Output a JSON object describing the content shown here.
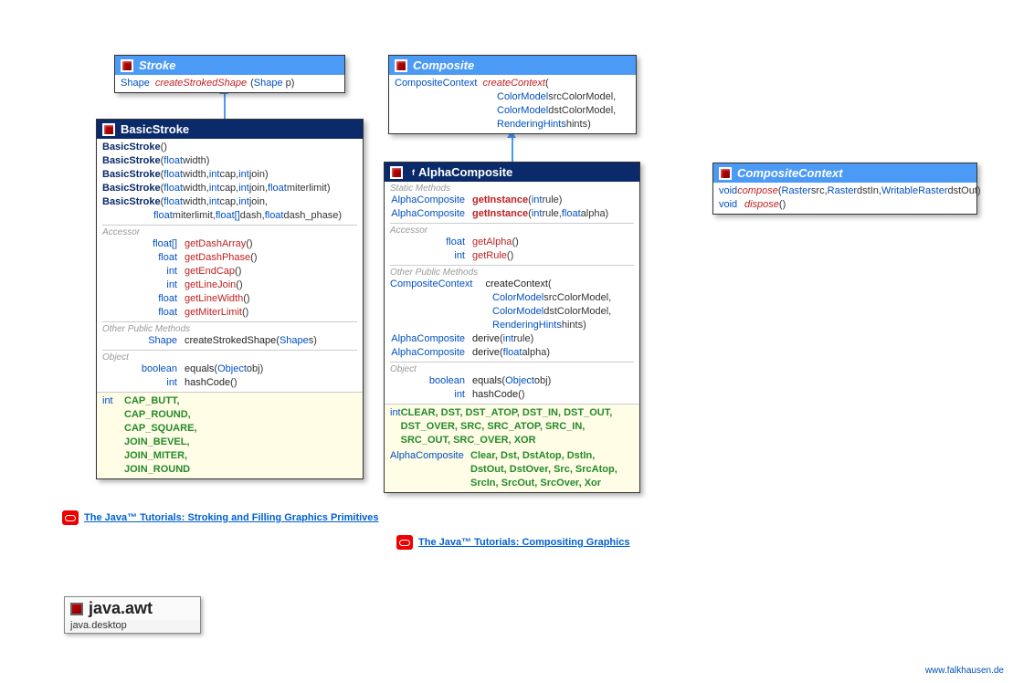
{
  "stroke": {
    "title": "Stroke",
    "method_ret": "Shape",
    "method_name": "createStrokedShape",
    "method_params": "(Shape p)"
  },
  "basicStroke": {
    "title": "BasicStroke",
    "constructors": [
      {
        "sig": "()"
      },
      {
        "sig": "(float width)"
      },
      {
        "sig": "(float width, int cap, int join)"
      },
      {
        "sig": "(float width, int cap, int join, float miterlimit)"
      },
      {
        "sig": "(float width, int cap, int join,",
        "cont": "float miterlimit, float[] dash, float dash_phase)"
      }
    ],
    "section_accessor": "Accessor",
    "accessors": [
      {
        "ret": "float[]",
        "name": "getDashArray",
        "params": "()"
      },
      {
        "ret": "float",
        "name": "getDashPhase",
        "params": "()"
      },
      {
        "ret": "int",
        "name": "getEndCap",
        "params": "()"
      },
      {
        "ret": "int",
        "name": "getLineJoin",
        "params": "()"
      },
      {
        "ret": "float",
        "name": "getLineWidth",
        "params": "()"
      },
      {
        "ret": "float",
        "name": "getMiterLimit",
        "params": "()"
      }
    ],
    "section_other": "Other Public Methods",
    "other_ret": "Shape",
    "other_name": "createStrokedShape",
    "other_params": "(Shape s)",
    "section_object": "Object",
    "equals_ret": "boolean",
    "equals_name": "equals",
    "equals_params": "(Object obj)",
    "hash_ret": "int",
    "hash_name": "hashCode",
    "hash_params": "()",
    "const_ret": "int",
    "constants": [
      "CAP_BUTT,",
      "CAP_ROUND,",
      "CAP_SQUARE,",
      "JOIN_BEVEL,",
      "JOIN_MITER,",
      "JOIN_ROUND"
    ]
  },
  "composite": {
    "title": "Composite",
    "ret": "CompositeContext",
    "name": "createContext",
    "open": "(",
    "p1": "ColorModel srcColorModel,",
    "p2": "ColorModel dstColorModel,",
    "p3": "RenderingHints hints)"
  },
  "alphaComposite": {
    "title": "AlphaComposite",
    "marker": "f",
    "section_static": "Static Methods",
    "getInstance1_ret": "AlphaComposite",
    "getInstance1_name": "getInstance",
    "getInstance1_params": "(int rule)",
    "getInstance2_ret": "AlphaComposite",
    "getInstance2_name": "getInstance",
    "getInstance2_params": "(int rule, float alpha)",
    "section_accessor": "Accessor",
    "getAlpha_ret": "float",
    "getAlpha_name": "getAlpha",
    "getAlpha_params": "()",
    "getRule_ret": "int",
    "getRule_name": "getRule",
    "getRule_params": "()",
    "section_other": "Other Public Methods",
    "cc_ret": "CompositeContext",
    "cc_name": "createContext",
    "cc_open": "(",
    "cc_p1": "ColorModel srcColorModel,",
    "cc_p2": "ColorModel dstColorModel,",
    "cc_p3": "RenderingHints hints)",
    "derive1_ret": "AlphaComposite",
    "derive1_name": "derive",
    "derive1_params": "(int rule)",
    "derive2_ret": "AlphaComposite",
    "derive2_name": "derive",
    "derive2_params": "(float alpha)",
    "section_object": "Object",
    "equals_ret": "boolean",
    "equals_name": "equals",
    "equals_params": "(Object obj)",
    "hash_ret": "int",
    "hash_name": "hashCode",
    "hash_params": "()",
    "int_const_ret": "int",
    "int_constants": "CLEAR, DST, DST_ATOP, DST_IN, DST_OUT, DST_OVER, SRC, SRC_ATOP, SRC_IN, SRC_OUT, SRC_OVER, XOR",
    "obj_const_ret": "AlphaComposite",
    "obj_constants": "Clear, Dst, DstAtop, DstIn, DstOut, DstOver, Src, SrcAtop, SrcIn, SrcOut, SrcOver, Xor"
  },
  "compositeContext": {
    "title": "CompositeContext",
    "compose_ret": "void",
    "compose_name": "compose",
    "compose_params": "(Raster src, Raster dstIn, WritableRaster dstOut)",
    "dispose_ret": "void",
    "dispose_name": "dispose",
    "dispose_params": "()"
  },
  "link1": "The Java™ Tutorials: Stroking and Filling Graphics Primitives",
  "link2": "The Java™ Tutorials: Compositing Graphics",
  "package": {
    "name": "java.awt",
    "module": "java.desktop"
  },
  "footer": "www.falkhausen.de"
}
